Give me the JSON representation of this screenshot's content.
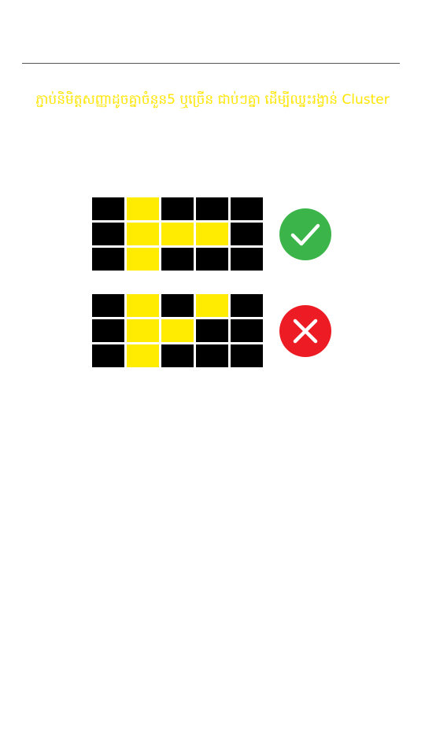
{
  "instruction": {
    "text": "ភ្ជាប់និមិត្តសញ្ញាដូចគ្នាចំនួន5 ឬច្រើន ជាប់ៗគ្នា ដើម្បីឈ្នះរង្វាន់ Cluster",
    "color": "#ffe600"
  },
  "examples": [
    {
      "kind": "correct",
      "icon": "checkmark-icon",
      "badge_color": "#3bb54a",
      "grid": [
        [
          0,
          1,
          0,
          0,
          0
        ],
        [
          0,
          1,
          1,
          1,
          0
        ],
        [
          0,
          1,
          0,
          0,
          0
        ]
      ]
    },
    {
      "kind": "incorrect",
      "icon": "cross-icon",
      "badge_color": "#ed1c24",
      "grid": [
        [
          0,
          1,
          0,
          1,
          0
        ],
        [
          0,
          1,
          1,
          0,
          0
        ],
        [
          0,
          1,
          0,
          0,
          0
        ]
      ]
    }
  ],
  "colors": {
    "symbol_on": "#ffec00",
    "symbol_off": "#000000"
  }
}
